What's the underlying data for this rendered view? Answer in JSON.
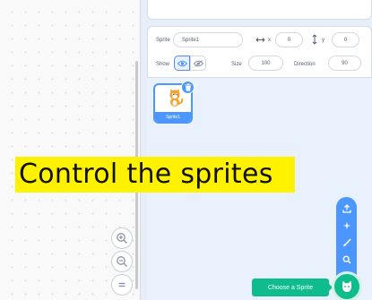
{
  "sprite_info": {
    "sprite_label": "Sprite",
    "sprite_name": "Sprite1",
    "x_label": "x",
    "x_value": "0",
    "y_label": "y",
    "y_value": "0",
    "show_label": "Show",
    "size_label": "Size",
    "size_value": "100",
    "direction_label": "Direction",
    "direction_value": "90"
  },
  "sprites": [
    {
      "name": "Sprite1",
      "selected": true
    }
  ],
  "caption": {
    "text": "Control the sprites"
  },
  "sprite_menu": {
    "items": [
      "upload-icon",
      "surprise-icon",
      "paint-icon",
      "search-icon"
    ],
    "tooltip": "Choose a Sprite"
  },
  "zoom_controls": [
    "zoom-in-icon",
    "zoom-out-icon",
    "zoom-reset-icon"
  ],
  "colors": {
    "accent": "#4c97ff",
    "choose_green": "#0fbd8c",
    "caption_bg": "#fff200"
  }
}
